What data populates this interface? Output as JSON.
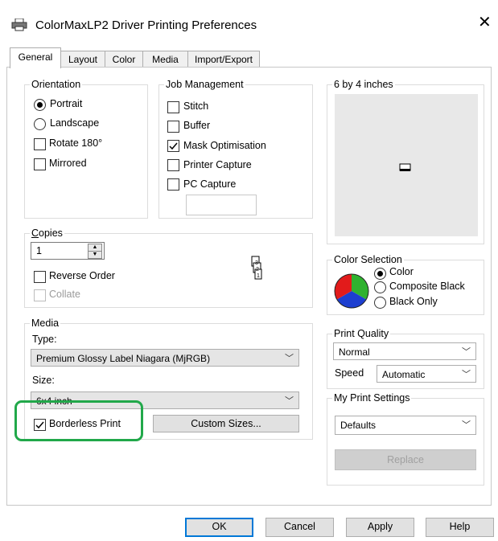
{
  "window": {
    "title": "ColorMaxLP2 Driver Printing Preferences",
    "close_glyph": "✕"
  },
  "tabs": [
    {
      "label": "General"
    },
    {
      "label": "Layout"
    },
    {
      "label": "Color"
    },
    {
      "label": "Media"
    },
    {
      "label": "Import/Export"
    }
  ],
  "orientation": {
    "legend": "Orientation",
    "portrait": {
      "label": "Portrait",
      "checked": true
    },
    "landscape": {
      "label": "Landscape",
      "checked": false
    },
    "rotate180": {
      "label": "Rotate 180°",
      "checked": false
    },
    "mirrored": {
      "label": "Mirrored",
      "checked": false
    }
  },
  "job_management": {
    "legend": "Job Management",
    "stitch": {
      "label": "Stitch",
      "checked": false
    },
    "buffer": {
      "label": "Buffer",
      "checked": false
    },
    "mask": {
      "label": "Mask Optimisation",
      "checked": true
    },
    "printer_capture": {
      "label": "Printer Capture",
      "checked": false
    },
    "pc_capture": {
      "label": "PC Capture",
      "checked": false
    },
    "capture_field_value": ""
  },
  "preview": {
    "legend": "6 by 4 inches"
  },
  "copies": {
    "legend": "Copies",
    "value": "1",
    "reverse_order": {
      "label": "Reverse Order",
      "checked": false
    },
    "collate": {
      "label": "Collate",
      "checked": false,
      "disabled": true
    }
  },
  "color_selection": {
    "legend": "Color Selection",
    "color": {
      "label": "Color",
      "checked": true
    },
    "composite_black": {
      "label": "Composite Black",
      "checked": false
    },
    "black_only": {
      "label": "Black Only",
      "checked": false
    }
  },
  "media": {
    "legend": "Media",
    "type_label": "Type:",
    "type_value": "Premium Glossy Label Niagara (MjRGB)",
    "size_label": "Size:",
    "size_value": "6x4 inch",
    "borderless": {
      "label": "Borderless Print",
      "checked": true
    },
    "custom_sizes_button": "Custom Sizes..."
  },
  "print_quality": {
    "legend": "Print Quality",
    "quality_value": "Normal",
    "speed_label": "Speed",
    "speed_value": "Automatic"
  },
  "my_print_settings": {
    "legend": "My Print Settings",
    "value": "Defaults",
    "replace_button": "Replace"
  },
  "footer": {
    "ok": "OK",
    "cancel": "Cancel",
    "apply": "Apply",
    "help": "Help"
  },
  "colors": {
    "highlight": "#21a84a",
    "accent": "#0078d7"
  }
}
